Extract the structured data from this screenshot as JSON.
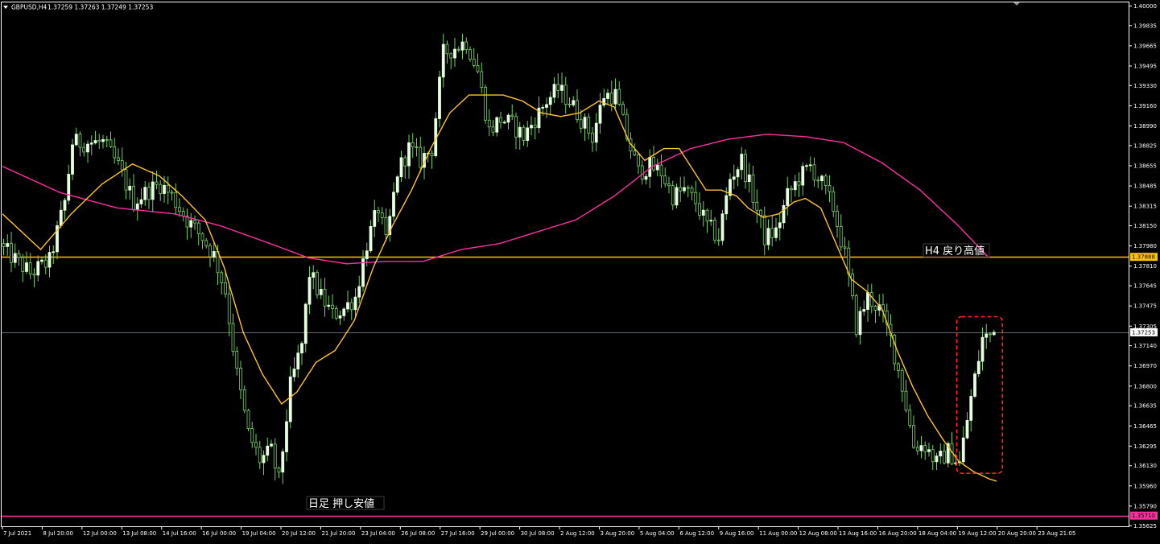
{
  "header": {
    "symbol": "GBPUSD,H4",
    "quote": "1.37259 1.37263 1.37249 1.37253"
  },
  "colors": {
    "background": "#000000",
    "frame": "#ffffff",
    "bull": "#e6ffe0",
    "bear": "#7bd36a",
    "wick": "#6fd15a",
    "ma_fast": "#ffc42a",
    "ma_slow": "#ff2fa0",
    "level_resistance": "#ffc400",
    "level_support": "#ff2fa0",
    "bid_line": "#7e8c9a",
    "highlight_box": "#ff2222"
  },
  "annotations": {
    "resistance": "H4  戻り高値",
    "support": "日足  押し安値"
  },
  "chart_data": {
    "type": "candlestick",
    "symbol": "GBPUSD",
    "timeframe": "H4",
    "ylim": [
      1.3562,
      1.4003
    ],
    "price_ticks": [
      "1.40000",
      "1.39835",
      "1.39665",
      "1.39495",
      "1.39330",
      "1.39160",
      "1.38990",
      "1.38825",
      "1.38655",
      "1.38485",
      "1.38315",
      "1.38150",
      "1.37980",
      "1.37810",
      "1.37645",
      "1.37475",
      "1.37305",
      "1.37140",
      "1.36970",
      "1.36800",
      "1.36635",
      "1.36465",
      "1.36295",
      "1.36130",
      "1.35960",
      "1.35790",
      "1.35625"
    ],
    "time_labels": [
      "7 Jul 2021",
      "8 Jul 20:00",
      "12 Jul 00:00",
      "13 Jul 08:00",
      "14 Jul 16:00",
      "16 Jul 00:00",
      "19 Jul 04:00",
      "20 Jul 12:00",
      "21 Jul 20:00",
      "23 Jul 04:00",
      "26 Jul 08:00",
      "27 Jul 16:00",
      "29 Jul 00:00",
      "30 Jul 08:00",
      "2 Aug 12:00",
      "3 Aug 20:00",
      "5 Aug 04:00",
      "6 Aug 12:00",
      "9 Aug 16:00",
      "11 Aug 00:00",
      "12 Aug 08:00",
      "13 Aug 16:00",
      "16 Aug 20:00",
      "18 Aug 04:00",
      "19 Aug 12:00",
      "20 Aug 20:00",
      "23 Aug 21:05"
    ],
    "close_anchors": [
      [
        0,
        1.3795
      ],
      [
        7,
        1.3775
      ],
      [
        12,
        1.3785
      ],
      [
        16,
        1.3835
      ],
      [
        18,
        1.3885
      ],
      [
        22,
        1.3885
      ],
      [
        26,
        1.3885
      ],
      [
        30,
        1.3865
      ],
      [
        34,
        1.3835
      ],
      [
        38,
        1.3845
      ],
      [
        41,
        1.385
      ],
      [
        44,
        1.384
      ],
      [
        48,
        1.382
      ],
      [
        52,
        1.3805
      ],
      [
        55,
        1.379
      ],
      [
        58,
        1.376
      ],
      [
        61,
        1.369
      ],
      [
        64,
        1.364
      ],
      [
        67,
        1.3618
      ],
      [
        70,
        1.3625
      ],
      [
        72,
        1.36
      ],
      [
        75,
        1.368
      ],
      [
        78,
        1.3715
      ],
      [
        80,
        1.3775
      ],
      [
        83,
        1.3755
      ],
      [
        86,
        1.374
      ],
      [
        89,
        1.3745
      ],
      [
        92,
        1.3755
      ],
      [
        95,
        1.38
      ],
      [
        98,
        1.383
      ],
      [
        100,
        1.38
      ],
      [
        103,
        1.386
      ],
      [
        106,
        1.388
      ],
      [
        109,
        1.387
      ],
      [
        112,
        1.388
      ],
      [
        115,
        1.396
      ],
      [
        118,
        1.3965
      ],
      [
        121,
        1.397
      ],
      [
        124,
        1.3945
      ],
      [
        127,
        1.3895
      ],
      [
        130,
        1.3905
      ],
      [
        133,
        1.39
      ],
      [
        136,
        1.389
      ],
      [
        139,
        1.3905
      ],
      [
        142,
        1.392
      ],
      [
        145,
        1.393
      ],
      [
        148,
        1.392
      ],
      [
        151,
        1.3905
      ],
      [
        154,
        1.389
      ],
      [
        157,
        1.3925
      ],
      [
        160,
        1.3925
      ],
      [
        163,
        1.389
      ],
      [
        166,
        1.386
      ],
      [
        169,
        1.3865
      ],
      [
        172,
        1.386
      ],
      [
        175,
        1.384
      ],
      [
        178,
        1.3845
      ],
      [
        181,
        1.3835
      ],
      [
        184,
        1.3815
      ],
      [
        187,
        1.3805
      ],
      [
        190,
        1.3855
      ],
      [
        193,
        1.387
      ],
      [
        196,
        1.384
      ],
      [
        199,
        1.3805
      ],
      [
        202,
        1.381
      ],
      [
        205,
        1.384
      ],
      [
        208,
        1.3855
      ],
      [
        211,
        1.3865
      ],
      [
        214,
        1.385
      ],
      [
        217,
        1.383
      ],
      [
        220,
        1.379
      ],
      [
        223,
        1.373
      ],
      [
        226,
        1.3755
      ],
      [
        229,
        1.3745
      ],
      [
        232,
        1.372
      ],
      [
        235,
        1.368
      ],
      [
        238,
        1.363
      ],
      [
        241,
        1.363
      ],
      [
        244,
        1.3615
      ],
      [
        247,
        1.3625
      ],
      [
        250,
        1.3615
      ],
      [
        253,
        1.367
      ],
      [
        256,
        1.372
      ],
      [
        258,
        1.3723
      ],
      [
        259,
        1.37253
      ]
    ],
    "ma_fast": [
      [
        0,
        1.3825
      ],
      [
        10,
        1.3795
      ],
      [
        18,
        1.3825
      ],
      [
        26,
        1.385
      ],
      [
        34,
        1.3867
      ],
      [
        41,
        1.3857
      ],
      [
        47,
        1.384
      ],
      [
        53,
        1.382
      ],
      [
        58,
        1.378
      ],
      [
        63,
        1.3725
      ],
      [
        68,
        1.369
      ],
      [
        73,
        1.3665
      ],
      [
        77,
        1.3675
      ],
      [
        82,
        1.37
      ],
      [
        87,
        1.371
      ],
      [
        92,
        1.3735
      ],
      [
        97,
        1.378
      ],
      [
        102,
        1.3815
      ],
      [
        107,
        1.3845
      ],
      [
        112,
        1.388
      ],
      [
        117,
        1.391
      ],
      [
        122,
        1.3925
      ],
      [
        126,
        1.3925
      ],
      [
        131,
        1.3925
      ],
      [
        136,
        1.392
      ],
      [
        141,
        1.391
      ],
      [
        146,
        1.3907
      ],
      [
        151,
        1.391
      ],
      [
        156,
        1.392
      ],
      [
        160,
        1.3915
      ],
      [
        164,
        1.3885
      ],
      [
        168,
        1.387
      ],
      [
        173,
        1.388
      ],
      [
        177,
        1.388
      ],
      [
        180,
        1.3865
      ],
      [
        184,
        1.3845
      ],
      [
        188,
        1.3845
      ],
      [
        192,
        1.384
      ],
      [
        195,
        1.383
      ],
      [
        199,
        1.3822
      ],
      [
        203,
        1.3825
      ],
      [
        207,
        1.3835
      ],
      [
        210,
        1.3838
      ],
      [
        214,
        1.383
      ],
      [
        218,
        1.38
      ],
      [
        222,
        1.377
      ],
      [
        226,
        1.376
      ],
      [
        230,
        1.3745
      ],
      [
        234,
        1.371
      ],
      [
        238,
        1.368
      ],
      [
        242,
        1.3655
      ],
      [
        246,
        1.3635
      ],
      [
        250,
        1.3617
      ],
      [
        254,
        1.3608
      ],
      [
        258,
        1.3602
      ],
      [
        260,
        1.36
      ]
    ],
    "ma_slow": [
      [
        0,
        1.3865
      ],
      [
        15,
        1.3843
      ],
      [
        30,
        1.383
      ],
      [
        45,
        1.3825
      ],
      [
        57,
        1.3815
      ],
      [
        70,
        1.38
      ],
      [
        80,
        1.3788
      ],
      [
        90,
        1.3783
      ],
      [
        100,
        1.3785
      ],
      [
        110,
        1.3785
      ],
      [
        120,
        1.3795
      ],
      [
        130,
        1.38
      ],
      [
        140,
        1.381
      ],
      [
        150,
        1.382
      ],
      [
        160,
        1.384
      ],
      [
        170,
        1.3865
      ],
      [
        180,
        1.388
      ],
      [
        190,
        1.3888
      ],
      [
        200,
        1.3892
      ],
      [
        210,
        1.389
      ],
      [
        220,
        1.3885
      ],
      [
        230,
        1.3868
      ],
      [
        240,
        1.3845
      ],
      [
        250,
        1.3815
      ],
      [
        258,
        1.3788
      ]
    ],
    "levels": [
      {
        "name": "resistance",
        "price": 1.37888,
        "label": "1.37888"
      },
      {
        "name": "support",
        "price": 1.3571,
        "label": "1.35710"
      },
      {
        "name": "bid",
        "price": 1.37253,
        "label": "1.37253"
      }
    ],
    "highlight_bars": [
      250,
      259
    ],
    "total_bars": 260
  }
}
